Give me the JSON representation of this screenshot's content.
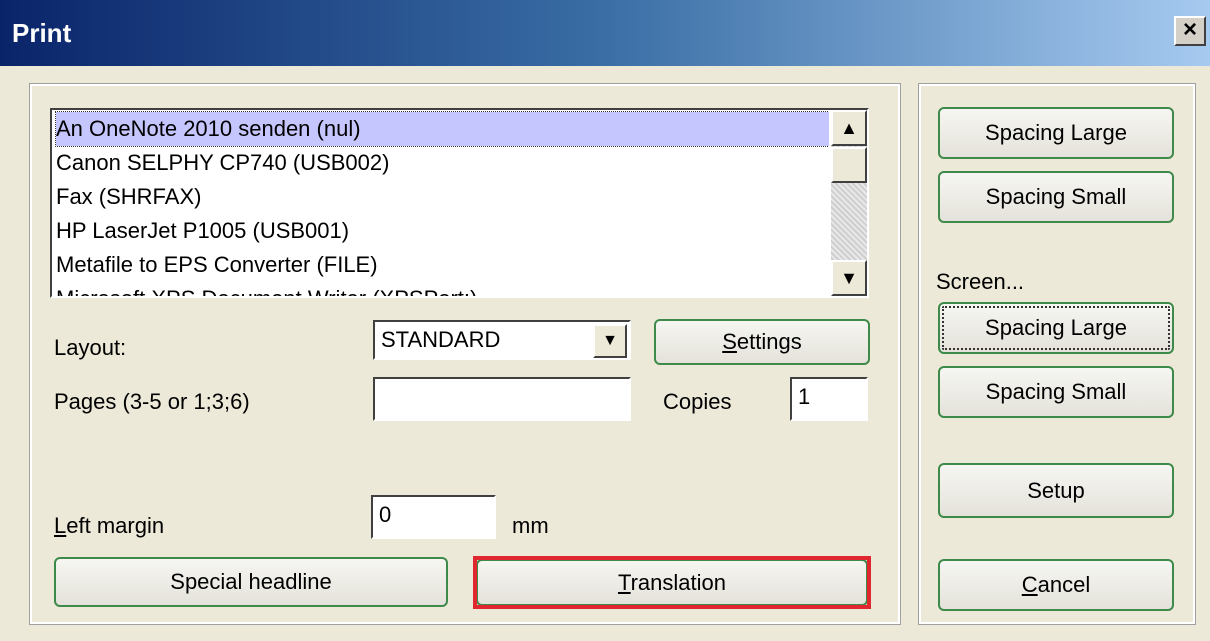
{
  "window": {
    "title": "Print",
    "close_label": "×"
  },
  "printers": {
    "items": [
      "An OneNote 2010 senden (nul)",
      "Canon SELPHY CP740 (USB002)",
      "Fax (SHRFAX)",
      "HP LaserJet P1005 (USB001)",
      "Metafile to EPS Converter (FILE)",
      "Microsoft XPS Document Writer (XPSPort:)"
    ],
    "selected_index": 0
  },
  "layout": {
    "label": "Layout:",
    "value": "STANDARD"
  },
  "settings_button": {
    "label_u": "S",
    "label_rest": "ettings"
  },
  "pages": {
    "label": "Pages (3-5 or 1;3;6)",
    "value": ""
  },
  "copies": {
    "label": "Copies",
    "value": "1"
  },
  "left_margin": {
    "label_u": "L",
    "label_rest": "eft margin",
    "value": "0",
    "unit": "mm"
  },
  "special_headline_button": {
    "label": "Special headline"
  },
  "translation_button": {
    "label_u": "T",
    "label_rest": "ranslation"
  },
  "print_group": {
    "spacing_large": "Spacing Large",
    "spacing_small": "Spacing Small"
  },
  "screen_group": {
    "label": "Screen...",
    "spacing_large": "Spacing Large",
    "spacing_small": "Spacing Small"
  },
  "setup_button": {
    "label": "Setup"
  },
  "cancel_button": {
    "label_u": "C",
    "label_rest": "ancel"
  },
  "icons": {
    "scroll_up": "▲",
    "scroll_down": "▼",
    "dropdown": "▼"
  },
  "colors": {
    "highlight": "#e0262e",
    "selection": "#c6c6ff",
    "button_border": "#3d8a4a"
  }
}
